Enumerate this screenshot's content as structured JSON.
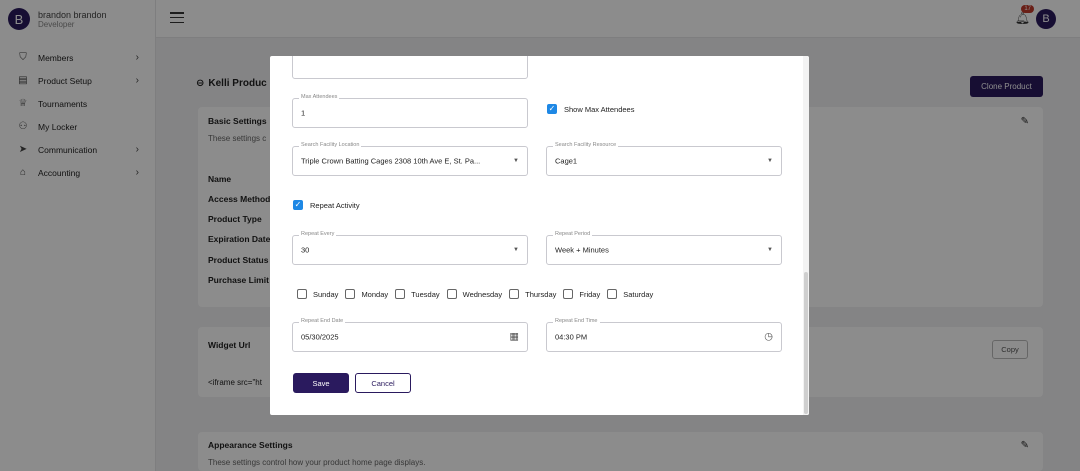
{
  "sidebar": {
    "avatar_letter": "B",
    "user_name": "brandon brandon",
    "user_role": "Developer",
    "items": [
      {
        "label": "Members",
        "icon": "shield-icon",
        "has_submenu": true
      },
      {
        "label": "Product Setup",
        "icon": "box-icon",
        "has_submenu": true
      },
      {
        "label": "Tournaments",
        "icon": "trophy-icon",
        "has_submenu": false
      },
      {
        "label": "My Locker",
        "icon": "users-icon",
        "has_submenu": false
      },
      {
        "label": "Communication",
        "icon": "send-icon",
        "has_submenu": true
      },
      {
        "label": "Accounting",
        "icon": "bank-icon",
        "has_submenu": true
      }
    ]
  },
  "topbar": {
    "notification_count": "17",
    "avatar_letter": "B"
  },
  "page": {
    "title": "Kelli Produc",
    "clone_label": "Clone Product",
    "basic_settings": {
      "title": "Basic Settings",
      "subtitle": "These settings c",
      "fields": [
        "Name",
        "Access Method",
        "Product Type",
        "Expiration Date",
        "Product Status",
        "Purchase Limit"
      ]
    },
    "widget": {
      "title": "Widget Url",
      "snippet": "<iframe src=\"ht",
      "copy_label": "Copy"
    },
    "appearance": {
      "title": "Appearance Settings",
      "subtitle": "These settings control how your product home page displays."
    }
  },
  "modal": {
    "max_attendees": {
      "label": "Max Attendees",
      "value": "1"
    },
    "show_max_attendees": {
      "label": "Show Max Attendees",
      "checked": true
    },
    "facility_location": {
      "label": "Search Facility Location",
      "value": "Triple Crown Batting Cages 2308 10th Ave E, St. Pa..."
    },
    "facility_resource": {
      "label": "Search Facility Resource",
      "value": "Cage1"
    },
    "repeat_activity": {
      "label": "Repeat Activity",
      "checked": true
    },
    "repeat_every": {
      "label": "Repeat Every",
      "value": "30"
    },
    "repeat_period": {
      "label": "Repeat Period",
      "value": "Week + Minutes"
    },
    "days": [
      "Sunday",
      "Monday",
      "Tuesday",
      "Wednesday",
      "Thursday",
      "Friday",
      "Saturday"
    ],
    "repeat_end_date": {
      "label": "Repeat End Date",
      "value": "05/30/2025"
    },
    "repeat_end_time": {
      "label": "Repeat End Time",
      "value": "04:30 PM"
    },
    "save_label": "Save",
    "cancel_label": "Cancel"
  },
  "colors": {
    "primary": "#2a1a5e",
    "checkbox": "#1e88e5"
  }
}
